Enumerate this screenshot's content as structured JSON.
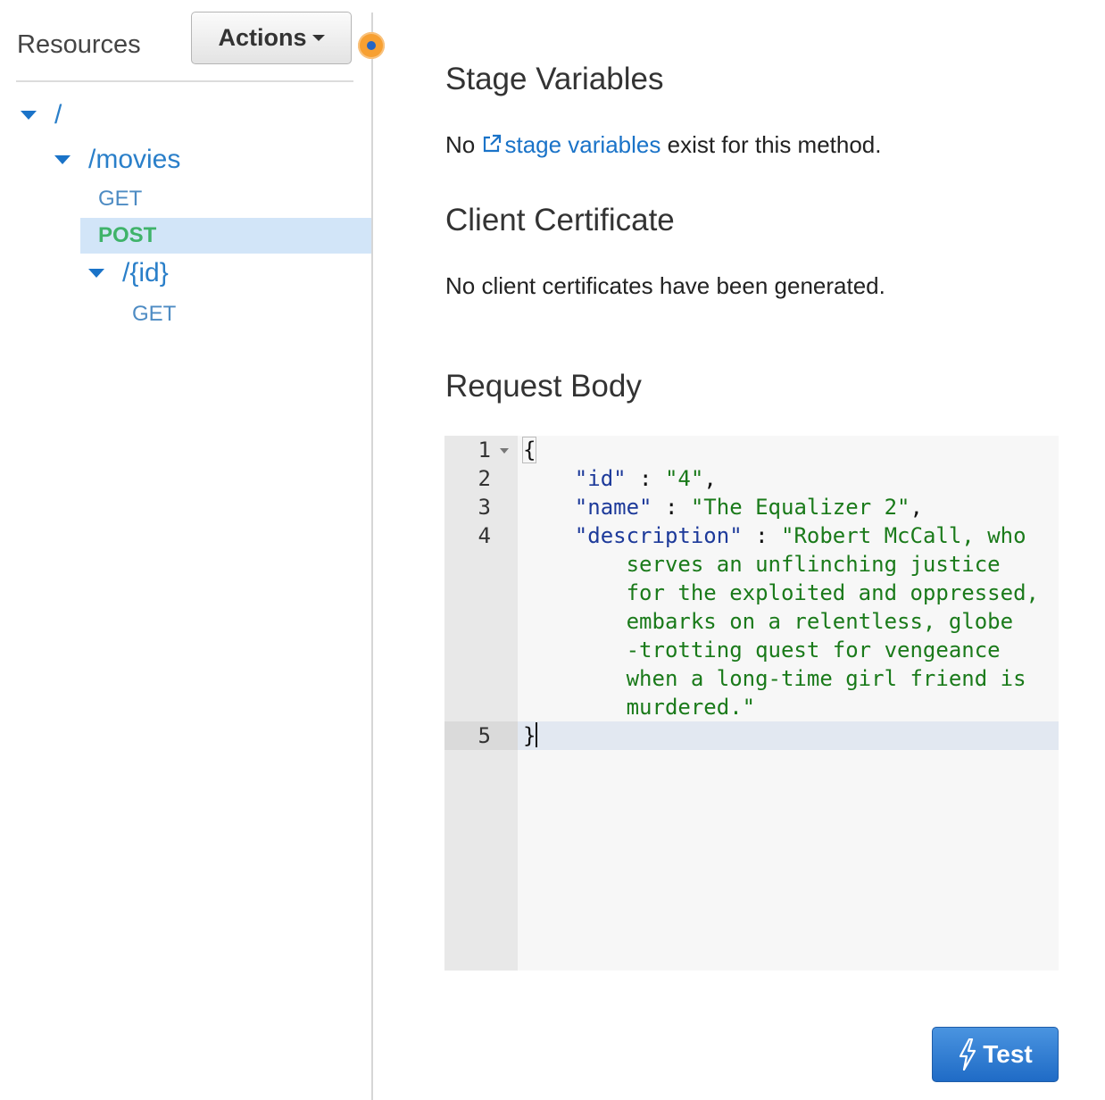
{
  "sidebar": {
    "title": "Resources",
    "actions_label": "Actions",
    "tree": {
      "root": "/",
      "movies": "/movies",
      "movies_get": "GET",
      "movies_post": "POST",
      "id": "/{id}",
      "id_get": "GET"
    }
  },
  "stage_variables": {
    "heading": "Stage Variables",
    "prefix": "No",
    "link": "stage variables",
    "suffix": "exist for this method."
  },
  "client_certificate": {
    "heading": "Client Certificate",
    "text": "No client certificates have been generated."
  },
  "request_body": {
    "heading": "Request Body",
    "line_numbers": [
      "1",
      "2",
      "3",
      "4",
      "5"
    ],
    "code": {
      "open_brace": "{",
      "k_id": "\"id\"",
      "v_id": "\"4\"",
      "k_name": "\"name\"",
      "v_name": "\"The Equalizer 2\"",
      "k_desc": "\"description\"",
      "v_desc_1": "\"Robert McCall, who",
      "v_desc_2": "serves an unflinching justice",
      "v_desc_3": "for the exploited and oppressed,",
      "v_desc_4": "embarks on a relentless, globe",
      "v_desc_5": "-trotting quest for vengeance",
      "v_desc_6": "when a long-time girl friend is",
      "v_desc_7": "murdered.\"",
      "close_brace": "}"
    }
  },
  "test_button": {
    "label": "Test"
  },
  "colors": {
    "link": "#1a73c8",
    "post_method": "#3fb36a",
    "selected_row": "#d2e5f8",
    "test_button": "#1f6bc6"
  }
}
